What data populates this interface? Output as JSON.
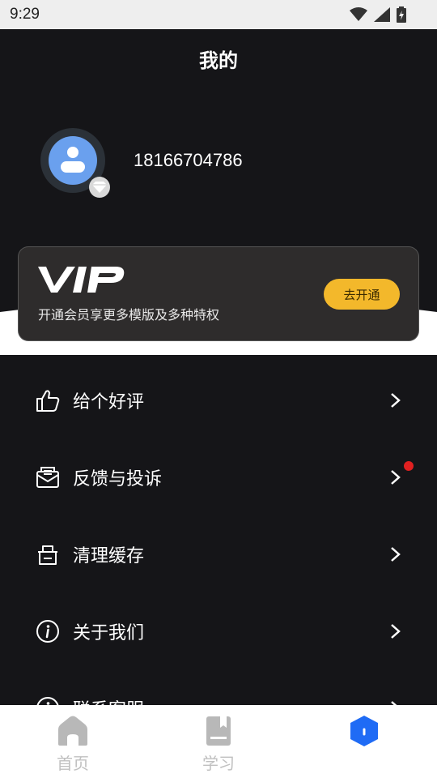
{
  "status_bar": {
    "time": "9:29"
  },
  "header": {
    "title": "我的"
  },
  "profile": {
    "phone": "18166704786"
  },
  "vip_card": {
    "logo_text": "VIP",
    "description": "开通会员享更多模版及多种特权",
    "button_label": "去开通",
    "accent_color": "#f3b82b"
  },
  "menu": {
    "items": [
      {
        "label": "给个好评",
        "icon": "thumbs-up-icon"
      },
      {
        "label": "反馈与投诉",
        "icon": "mail-feedback-icon",
        "badge": true
      },
      {
        "label": "清理缓存",
        "icon": "basket-icon"
      },
      {
        "label": "关于我们",
        "icon": "info-icon"
      },
      {
        "label": "联系客服",
        "icon": "info-icon"
      }
    ]
  },
  "tabbar": {
    "tabs": [
      {
        "label": "首页",
        "icon": "home-icon"
      },
      {
        "label": "学习",
        "icon": "book-icon"
      },
      {
        "label": "",
        "icon": "profile-hexagon-icon",
        "active": true
      }
    ],
    "active_color": "#1f6bf5"
  }
}
